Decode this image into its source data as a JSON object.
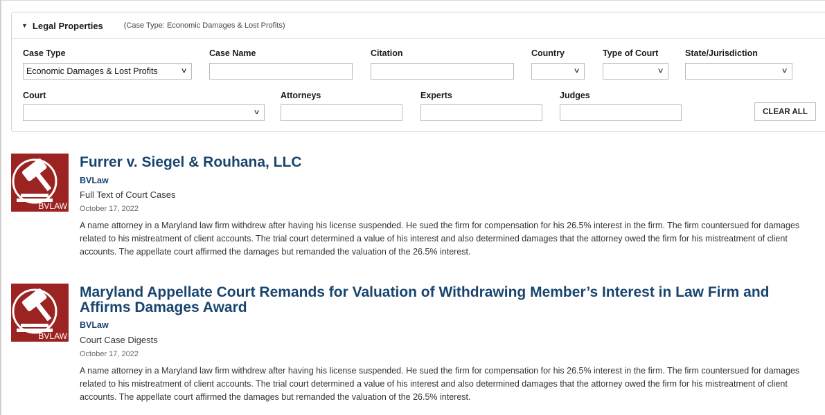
{
  "panel": {
    "title": "Legal Properties",
    "subtitle": "(Case Type: Economic Damages & Lost Profits)",
    "fields": {
      "case_type": {
        "label": "Case Type",
        "value": "Economic Damages & Lost Profits"
      },
      "case_name": {
        "label": "Case Name",
        "value": ""
      },
      "citation": {
        "label": "Citation",
        "value": ""
      },
      "country": {
        "label": "Country",
        "value": ""
      },
      "type_of_court": {
        "label": "Type of Court",
        "value": ""
      },
      "state_jurisdiction": {
        "label": "State/Jurisdiction",
        "value": ""
      },
      "court": {
        "label": "Court",
        "value": ""
      },
      "attorneys": {
        "label": "Attorneys",
        "value": ""
      },
      "experts": {
        "label": "Experts",
        "value": ""
      },
      "judges": {
        "label": "Judges",
        "value": ""
      }
    },
    "clear_all_label": "CLEAR ALL"
  },
  "results": [
    {
      "logo_text": "BVLAW",
      "title": "Furrer v. Siegel & Rouhana, LLC",
      "source": "BVLaw",
      "type": "Full Text of Court Cases",
      "date": "October 17, 2022",
      "summary": "A name attorney in a Maryland law firm withdrew after having his license suspended. He sued the firm for compensation for his 26.5% interest in the firm. The firm countersued for damages related to his mistreatment of client accounts. The trial court determined a value of his interest and also determined damages that the attorney owed the firm for his mistreatment of client accounts. The appellate court affirmed the damages but remanded the valuation of the 26.5% interest."
    },
    {
      "logo_text": "BVLAW",
      "title": "Maryland Appellate Court Remands for Valuation of Withdrawing Member’s Interest in Law Firm and Affirms Damages Award",
      "source": "BVLaw",
      "type": "Court Case Digests",
      "date": "October 17, 2022",
      "summary": "A name attorney in a Maryland law firm withdrew after having his license suspended. He sued the firm for compensation for his 26.5% interest in the firm. The firm countersued for damages related to his mistreatment of client accounts. The trial court determined a value of his interest and also determined damages that the attorney owed the firm for his mistreatment of client accounts. The appellate court affirmed the damages but remanded the valuation of the 26.5% interest."
    }
  ],
  "icons": {
    "collapse": "caret-down-icon",
    "dropdown": "chevron-down-icon",
    "logo": "gavel-icon"
  },
  "colors": {
    "title": "#18446e",
    "logo_bg": "#9b2422"
  }
}
